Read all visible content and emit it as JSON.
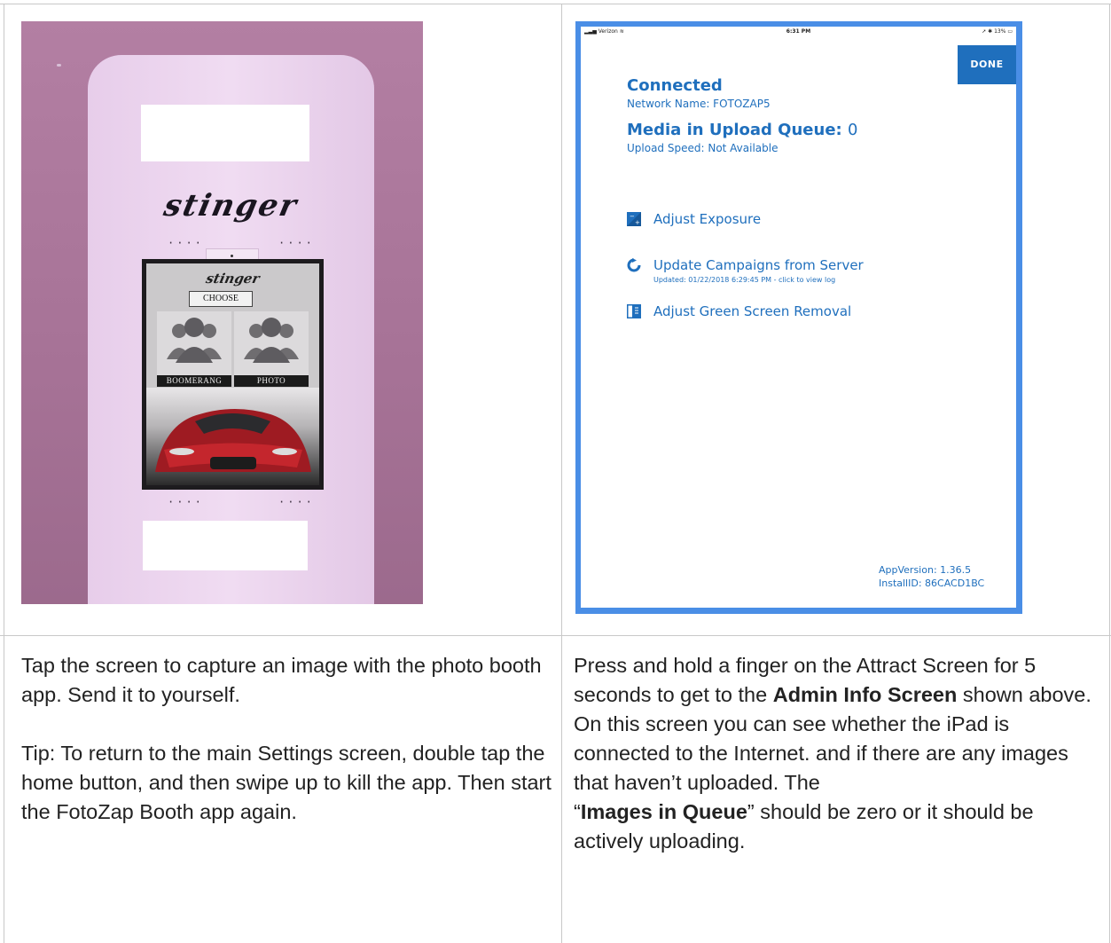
{
  "left_photo": {
    "kiosk_brand": "stinger",
    "tablet_brand": "stinger",
    "choose_label": "CHOOSE",
    "tiles": [
      "BOOMERANG",
      "PHOTO"
    ]
  },
  "admin_screen": {
    "statusbar": {
      "carrier": "Verizon",
      "time": "6:31 PM",
      "battery": "13%"
    },
    "done_label": "DONE",
    "connected_heading": "Connected",
    "network_name": "Network Name: FOTOZAP5",
    "queue_heading": "Media in Upload Queue:",
    "queue_count": "0",
    "upload_speed": "Upload Speed: Not Available",
    "menu": {
      "adjust_exposure": "Adjust Exposure",
      "update_campaigns": "Update Campaigns from Server",
      "update_note": "Updated: 01/22/2018 6:29:45 PM - click to view log",
      "green_screen": "Adjust Green Screen Removal"
    },
    "app_version": "AppVersion: 1.36.5",
    "install_id": "InstallID: 86CACD1BC"
  },
  "left_text": {
    "p1": "Tap the screen to capture an image with the photo booth app. Send it to yourself.",
    "p2": "Tip: To return to the main Settings screen, double tap the home button, and then swipe up to kill the app. Then start the FotoZap Booth app again."
  },
  "right_text": {
    "p1_start": "Press and hold a finger on the Attract Screen for 5 seconds to get to the ",
    "p1_bold": "Admin Info Screen",
    "p1_end": " shown above.",
    "p2": "On this screen you can see whether the iPad is connected to the Internet. and if there are any images that haven’t uploaded. The ",
    "p2_quote_open": "“",
    "p2_bold": "Images in Queue",
    "p2_end": "” should be zero or it should be actively uploading."
  }
}
